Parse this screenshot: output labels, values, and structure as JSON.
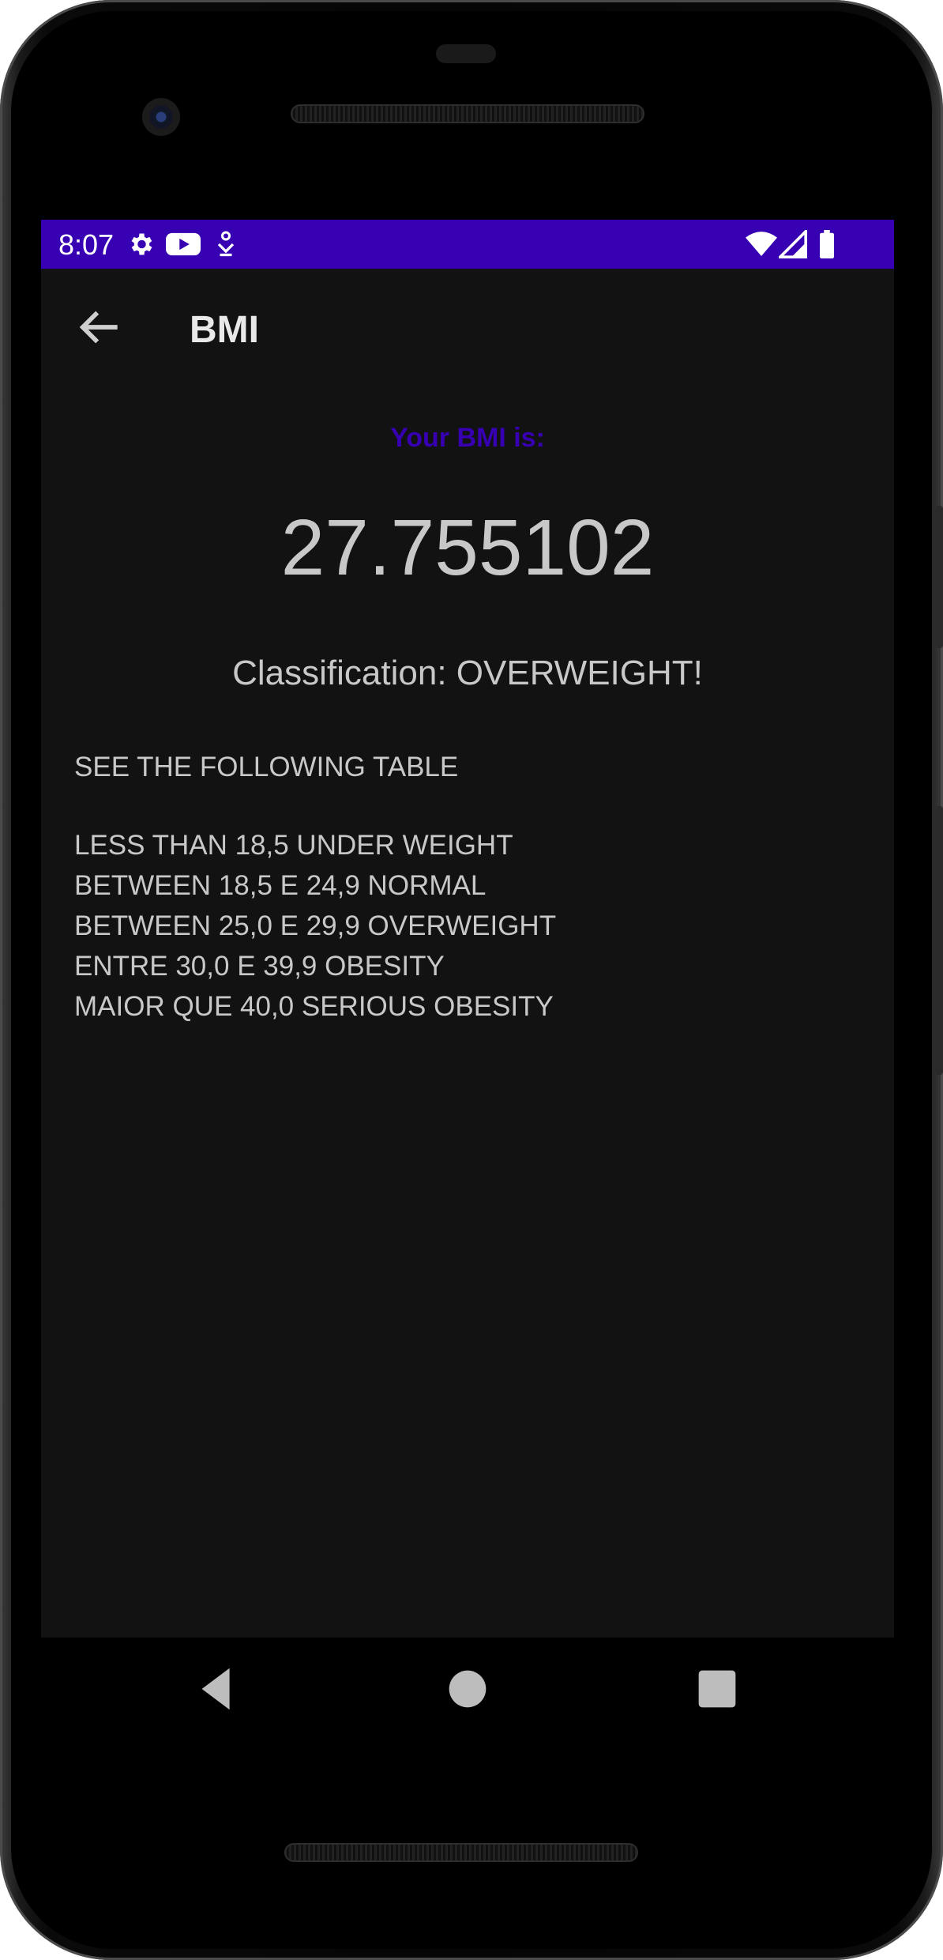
{
  "status_bar": {
    "time": "8:07",
    "left_icons": [
      "gear-icon",
      "youtube-icon",
      "download-icon"
    ],
    "right_icons": [
      "wifi-icon",
      "signal-icon",
      "battery-icon"
    ],
    "background": "#3700b3"
  },
  "app_bar": {
    "title": "BMI",
    "back_icon": "arrow-back-icon"
  },
  "result": {
    "label": "Your BMI is:",
    "value": "27.755102",
    "classification": "Classification: OVERWEIGHT!",
    "label_color": "#3700b3"
  },
  "table": {
    "heading": "SEE THE FOLLOWING TABLE",
    "rows": [
      "LESS THAN 18,5 UNDER WEIGHT",
      "BETWEEN 18,5 E 24,9 NORMAL",
      "BETWEEN 25,0 E 29,9 OVERWEIGHT",
      "ENTRE 30,0 E 39,9 OBESITY",
      "MAIOR QUE 40,0 SERIOUS OBESITY"
    ]
  },
  "nav_bar": {
    "buttons": [
      "back-triangle-icon",
      "home-circle-icon",
      "recents-square-icon"
    ]
  },
  "colors": {
    "screen_background": "#121212",
    "text": "#c8c8c8"
  }
}
